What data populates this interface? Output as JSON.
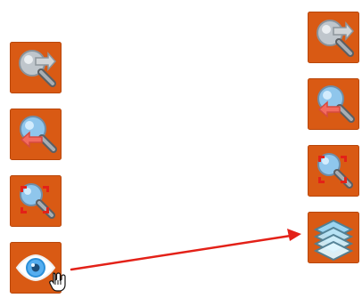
{
  "colors": {
    "button_background": "#d95a14",
    "button_border": "#b94609",
    "arrow": "#e32118"
  },
  "left_toolbar": {
    "items": [
      {
        "icon": "zoom-out-icon"
      },
      {
        "icon": "zoom-in-icon"
      },
      {
        "icon": "zoom-extent-icon"
      },
      {
        "icon": "eye-icon"
      }
    ]
  },
  "right_toolbar": {
    "items": [
      {
        "icon": "zoom-out-icon"
      },
      {
        "icon": "zoom-in-icon"
      },
      {
        "icon": "zoom-extent-icon"
      },
      {
        "icon": "layers-icon"
      }
    ]
  },
  "cursor": {
    "icon": "hand-cursor-icon"
  },
  "annotation": {
    "icon": "red-arrow-icon"
  }
}
